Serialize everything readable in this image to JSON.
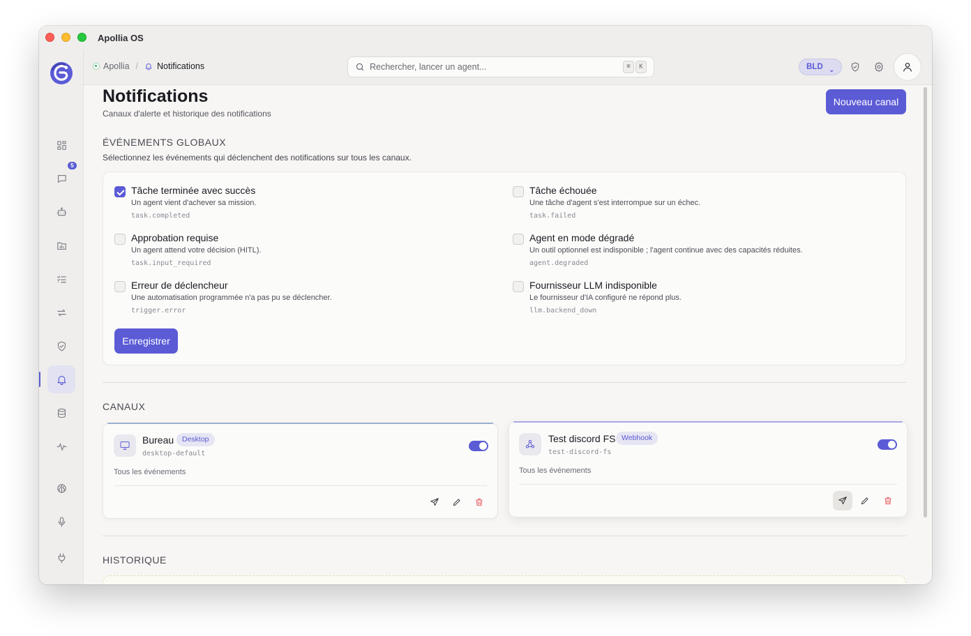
{
  "window": {
    "title": "Apollia OS"
  },
  "sidebar": {
    "chat_badge": "5"
  },
  "breadcrumb": {
    "root": "Apollia",
    "separator": "/",
    "current": "Notifications"
  },
  "search": {
    "placeholder": "Rechercher, lancer un agent...",
    "shortcut": [
      "⌘",
      "K"
    ]
  },
  "header": {
    "workspace": "BLD"
  },
  "page": {
    "title": "Notifications",
    "subtitle": "Canaux d'alerte et historique des notifications",
    "new_channel_label": "Nouveau canal"
  },
  "global_events": {
    "title": "ÉVÉNEMENTS GLOBAUX",
    "description": "Sélectionnez les événements qui déclenchent des notifications sur tous les canaux.",
    "items": [
      {
        "title": "Tâche terminée avec succès",
        "description": "Un agent vient d'achever sa mission.",
        "code": "task.completed",
        "checked": true
      },
      {
        "title": "Tâche échouée",
        "description": "Une tâche d'agent s'est interrompue sur un échec.",
        "code": "task.failed",
        "checked": false
      },
      {
        "title": "Approbation requise",
        "description": "Un agent attend votre décision (HITL).",
        "code": "task.input_required",
        "checked": false
      },
      {
        "title": "Agent en mode dégradé",
        "description": "Un outil optionnel est indisponible ; l'agent continue avec des capacités réduites.",
        "code": "agent.degraded",
        "checked": false
      },
      {
        "title": "Erreur de déclencheur",
        "description": "Une automatisation programmée n'a pas pu se déclencher.",
        "code": "trigger.error",
        "checked": false
      },
      {
        "title": "Fournisseur LLM indisponible",
        "description": "Le fournisseur d'IA configuré ne répond plus.",
        "code": "llm.backend_down",
        "checked": false
      }
    ],
    "save_label": "Enregistrer"
  },
  "channels": {
    "title": "CANAUX",
    "items": [
      {
        "name": "Bureau",
        "type": "Desktop",
        "id": "desktop-default",
        "events": "Tous les événements",
        "enabled": true,
        "icon": "monitor-icon"
      },
      {
        "name": "Test discord FS",
        "type": "Webhook",
        "id": "test-discord-fs",
        "events": "Tous les événements",
        "enabled": true,
        "icon": "webhook-icon"
      }
    ]
  },
  "history": {
    "title": "HISTORIQUE"
  },
  "colors": {
    "accent": "#5b5bd6",
    "danger": "#e5484d",
    "status_online": "#30a46c"
  }
}
